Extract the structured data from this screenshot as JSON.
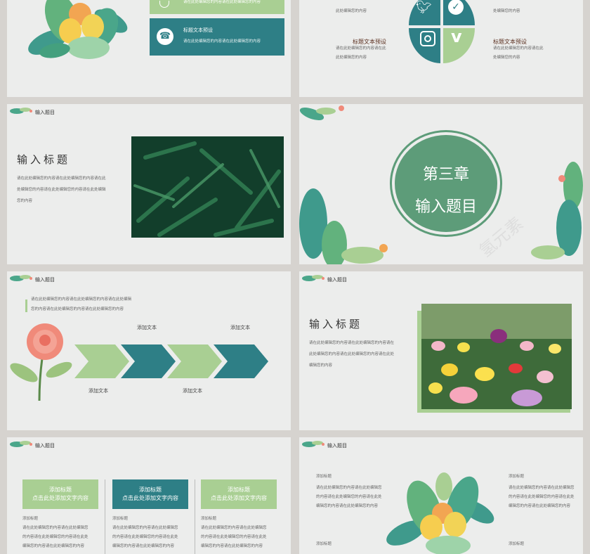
{
  "slide1": {
    "card_top_text": "请在此处编辑您的内容请在此处编辑您的内容",
    "card_title": "标题文本预设",
    "card_text": "请在此处编辑您的内容请在此处编辑您的内容"
  },
  "slide2": {
    "left_top_text": "此处编辑您的内容",
    "right_top_text": "处编辑您的内容",
    "left_title": "标题文本预设",
    "left_text1": "请在此处编辑您的内容请在此",
    "left_text2": "此处编辑您的内容",
    "right_title": "标题文本预设",
    "right_text1": "请在此处编辑您的内容请在此",
    "right_text2": "处编辑您的内容",
    "icons": [
      "twitter-icon",
      "check-icon",
      "instagram-icon",
      "vimeo-icon"
    ]
  },
  "slide3": {
    "header": "输入题目",
    "title": "输入标题",
    "body1": "请在此处编辑您的内容请在此处编辑您的内容请在此",
    "body2": "处编辑您的内容请在此处编辑您的内容请在此处编辑",
    "body3": "您的内容"
  },
  "slide4": {
    "chapter": "第三章",
    "subtitle": "输入题目",
    "watermark": "氢元素"
  },
  "slide5": {
    "header": "输入题目",
    "quote1": "请在此处编辑您的内容请在此处编辑您的内容请在此处编辑",
    "quote2": "您的内容请在此处编辑您的内容请在此处编辑您的内容",
    "label_top1": "添加文本",
    "label_top2": "添加文本",
    "label_bottom1": "添加文本",
    "label_bottom2": "添加文本"
  },
  "slide6": {
    "header": "输入题目",
    "title": "输入标题",
    "body1": "请在此处编辑您的内容请在此处编辑您的内容请在",
    "body2": "此处编辑您的内容请在此处编辑您的内容请在此处",
    "body3": "编辑您的内容"
  },
  "slide7": {
    "header": "输入题目",
    "cols": [
      {
        "b1": "添加标题",
        "b2": "点击此处添加文字内容",
        "label": "添加标题",
        "t1": "请在此处编辑您的内容请在此处编辑您",
        "t2": "的内容请在此处编辑您的内容请在此处",
        "t3": "编辑您的内容请在此处编辑您的内容"
      },
      {
        "b1": "添加标题",
        "b2": "点击此处添加文字内容",
        "label": "添加标题",
        "t1": "请在此处编辑您的内容请在此处编辑您",
        "t2": "的内容请在此处编辑您的内容请在此处",
        "t3": "编辑您的内容请在此处编辑您的内容"
      },
      {
        "b1": "添加标题",
        "b2": "点击此处添加文字内容",
        "label": "添加标题",
        "t1": "请在此处编辑您的内容请在此处编辑您",
        "t2": "的内容请在此处编辑您的内容请在此处",
        "t3": "编辑您的内容请在此处编辑您的内容"
      }
    ]
  },
  "slide8": {
    "header": "输入题目",
    "left_title": "添加标题",
    "left1": "请在此处编辑您的内容请在此处编辑您",
    "left2": "的内容请在此处编辑您的内容请在此处",
    "left3": "编辑您的内容请在此处编辑您的内容",
    "left_title2": "添加标题",
    "right_title": "添加标题",
    "right1": "请在此处编辑您的内容请在此处编辑您",
    "right2": "的内容请在此处编辑您的内容请在此处",
    "right3": "编辑您的内容请在此处编辑您的内容",
    "right_title2": "添加标题"
  },
  "colors": {
    "teal": "#2e7f86",
    "sage": "#5d9c79",
    "light_green": "#a9cf93",
    "bg": "#ecedec"
  }
}
